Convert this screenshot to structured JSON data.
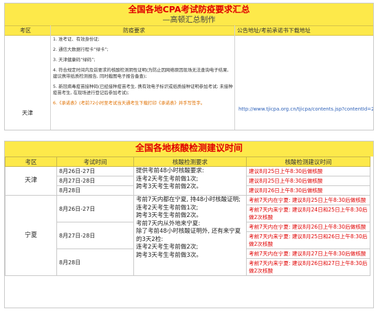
{
  "top_table": {
    "title": "全国各地CPA考试防疫要求汇总",
    "subtitle": "—高顿汇总制作",
    "headers": [
      "考区",
      "防疫要求",
      "公告地址/考前承诺书下载地址"
    ],
    "region": "天津",
    "requirements": [
      "1. 准考证、有效身份证;",
      "2. 通信大数据行程卡“绿卡”;",
      "3. 天津健康码“绿码”;",
      "4. 符合规定时间内及前要求的核酸检测阴性证明(为防止因网络原因现场无法查询电子结果, 建议携带纸质检测报告, 同时截图电子报告备查);",
      "5. 新冠病毒疫苗接种码(已经接种疫苗考生, 携有效电子标识或纸质接种证明参加考试; 未接种疫苗考生, 在现场进行登记后参加考试);",
      "6.《承诺表》(考前72小时至考试当天通考生下载打印《承诺表》并手写签字。"
    ],
    "link": "http://www.tjicpa.org.cn/tjicpa/contents.jsp?contentId=2"
  },
  "bottom_table": {
    "title": "全国各地核酸检测建议时间",
    "headers": [
      "考区",
      "考试时间",
      "核酸检测要求",
      "核酸检测建议时间"
    ],
    "tianjin": {
      "region": "天津",
      "dates": [
        "8月26日-27日",
        "8月27日-28日",
        "8月28日"
      ],
      "requirement": "提供考前48小时核酸要求:\n连考2天考生考前做1次;\n跨考3天考生考前做2次。",
      "suggestions": [
        "建议8月25日上午8:30后做核酸",
        "建议8月25日上午8:30后做核酸",
        "建议8月26日上午8:30后做核酸"
      ]
    },
    "ningxia": {
      "region": "宁夏",
      "dates": [
        "8月26日-27日",
        "8月27日-28日",
        "8月28日"
      ],
      "requirement": "考前7天内都在宁夏, 持48小时核酸证明;\n连考2天考生考前做1次;\n跨考3天考生考前做2次。\n考前7天内从外地来宁夏:\n除了考前48小时核酸证明外, 还有来宁夏的3天2检:\n连考2天考生考前做2次;\n跨考3天考生考前做3次。",
      "suggestions": [
        "考前7天内在宁夏: 建议8月25日上午8:30后做核酸",
        "考前7天内来宁夏: 建议8月24日和25日上午8:30后做2次核酸",
        "考前7天内在宁夏: 建议8月26日上午8:30后做核酸",
        "考前7天内来宁夏: 建议8月25日和26日上午8:30后做2次核酸",
        "考前7天内在宁夏: 建议8月27日上午8:30后做核酸",
        "考前7天内来宁夏: 建议8月26日和27日上午8:30后做2次核酸"
      ]
    }
  }
}
